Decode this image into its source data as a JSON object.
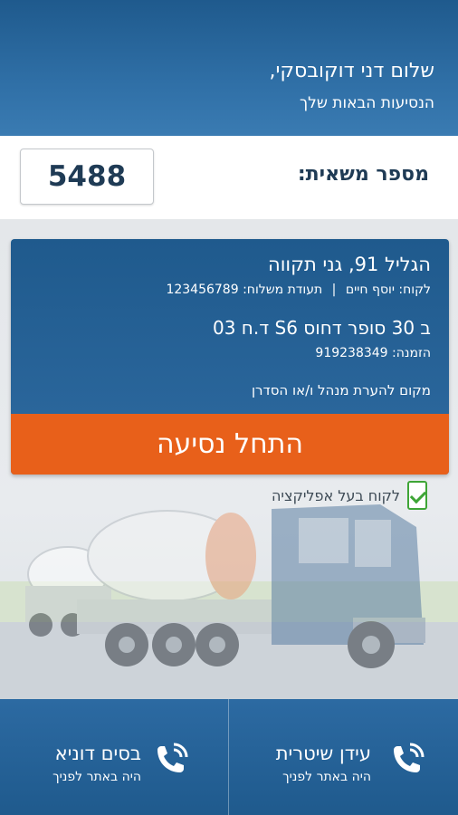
{
  "header": {
    "greeting": "שלום דני דוקובסקי,",
    "subtitle": "הנסיעות הבאות שלך"
  },
  "truck": {
    "label": "מספר משאית:",
    "number": "5488"
  },
  "trip": {
    "address": "הגליל 91, גני תקווה",
    "customer": "לקוח: יוסף חיים",
    "separator": "|",
    "delivery_note": "תעודת משלוח: 123456789",
    "product": "ב 30 סופר דחוס S6 ד.ח 03",
    "order": "הזמנה: 919238349",
    "comment_placeholder": "מקום להערת מנהל ו/או הסדרן",
    "start_button": "התחל נסיעה"
  },
  "app_customer": {
    "label": "לקוח בעל אפליקציה",
    "icon": "phone-check-icon",
    "color": "#3ea536"
  },
  "contacts": [
    {
      "name": "עידן שיטרית",
      "status": "היה באתר לפניך",
      "icon": "phone-call-icon"
    },
    {
      "name": "בסים דוניא",
      "status": "היה באתר לפניך",
      "icon": "phone-call-icon"
    }
  ],
  "colors": {
    "primary": "#1f5a8d",
    "accent": "#e8601a",
    "success": "#3ea536"
  }
}
